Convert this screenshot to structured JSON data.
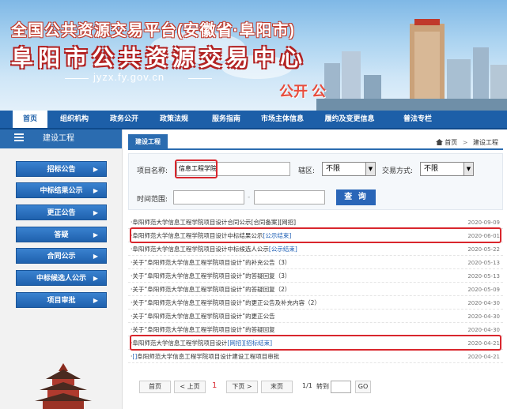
{
  "banner": {
    "title_line1": "全国公共资源交易平台(安徽省·阜阳市)",
    "title_line2": "阜阳市公共资源交易中心",
    "url": "jyzx.fy.gov.cn",
    "tagline": "公开 公"
  },
  "nav": {
    "items": [
      "首页",
      "组织机构",
      "政务公开",
      "政策法规",
      "服务指南",
      "市场主体信息",
      "履约及变更信息",
      "普法专栏"
    ],
    "active_index": 0
  },
  "sidebar": {
    "header": "建设工程",
    "items": [
      "招标公告",
      "中标结果公示",
      "更正公告",
      "答疑",
      "合同公示",
      "中标候选人公示",
      "项目审批"
    ],
    "arrow": "▶"
  },
  "main": {
    "tab": "建设工程",
    "breadcrumb": {
      "home": "首页",
      "sep": ">",
      "current": "建设工程"
    },
    "search": {
      "name_label": "项目名称:",
      "name_value": "信息工程学院",
      "district_label": "辖区:",
      "district_value": "不限",
      "mode_label": "交易方式:",
      "mode_value": "不限",
      "time_label": "时间范围:",
      "time_sep": "-",
      "query_button": "查 询"
    },
    "results": [
      {
        "title": "阜阳师范大学信息工程学院项目设计合同公示",
        "tag": "[合同备案]",
        "suffix": "[网招]",
        "date": "2020-09-09"
      },
      {
        "title": "阜阳师范大学信息工程学院项目设计中标结果公示",
        "tag": "[公示结束]",
        "suffix": "",
        "date": "2020-06-01"
      },
      {
        "title": "阜阳师范大学信息工程学院项目设计中标候选人公示",
        "tag": "[公示结束]",
        "suffix": "",
        "date": "2020-05-22"
      },
      {
        "title": "关于“阜阳师范大学信息工程学院项目设计”的补充公告（3）",
        "tag": "",
        "suffix": "",
        "date": "2020-05-13"
      },
      {
        "title": "关于“阜阳师范大学信息工程学院项目设计”的答疑回复（3）",
        "tag": "",
        "suffix": "",
        "date": "2020-05-13"
      },
      {
        "title": "关于“阜阳师范大学信息工程学院项目设计”的答疑回复（2）",
        "tag": "",
        "suffix": "",
        "date": "2020-05-09"
      },
      {
        "title": "关于“阜阳师范大学信息工程学院项目设计”的更正公告及补充内容（2）",
        "tag": "",
        "suffix": "",
        "date": "2020-04-30"
      },
      {
        "title": "关于“阜阳师范大学信息工程学院项目设计”的更正公告",
        "tag": "",
        "suffix": "",
        "date": "2020-04-30"
      },
      {
        "title": "关于“阜阳师范大学信息工程学院项目设计”的答疑回复",
        "tag": "",
        "suffix": "",
        "date": "2020-04-30"
      },
      {
        "title": "阜阳师范大学信息工程学院项目设计",
        "tag": "[网招][招标结束]",
        "suffix": "",
        "date": "2020-04-21"
      },
      {
        "title": "阜阳师范大学信息工程学院项目设计建设工程项目审批",
        "tag": "[]",
        "suffix": "",
        "date": "2020-04-21"
      }
    ],
    "pager": {
      "first": "首页",
      "prev": "< 上页",
      "current": "1",
      "next": "下页 >",
      "last": "末页",
      "info": "1/1",
      "goto_label": "转到",
      "go": "GO"
    }
  },
  "colors": {
    "nav_blue": "#1d5fa8",
    "highlight_red": "#d9262d",
    "link_blue": "#1e5fb5"
  }
}
